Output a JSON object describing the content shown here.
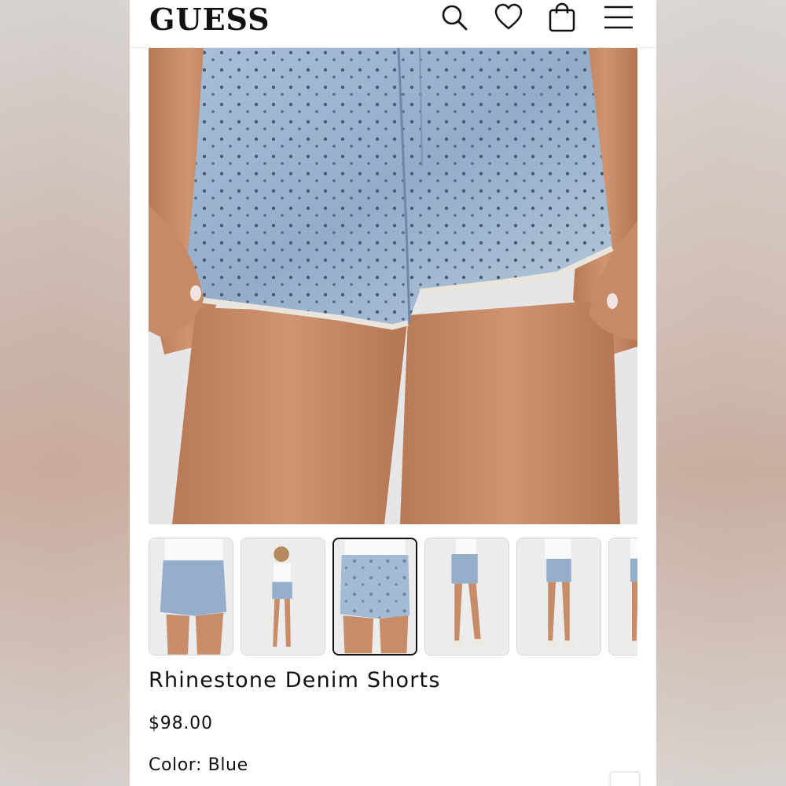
{
  "header": {
    "logo": "GUESS",
    "icons": [
      "search-icon",
      "heart-icon",
      "shopping-bag-icon",
      "menu-icon"
    ]
  },
  "product": {
    "title": "Rhinestone Denim Shorts",
    "price": "$98.00",
    "color_label": "Color: Blue"
  },
  "gallery": {
    "thumbnail_count": 6,
    "selected_index": 2
  },
  "colors": {
    "background": "#ffffff",
    "text": "#111111",
    "denim": "#8fa9c6",
    "skin": "#c98e6a"
  }
}
